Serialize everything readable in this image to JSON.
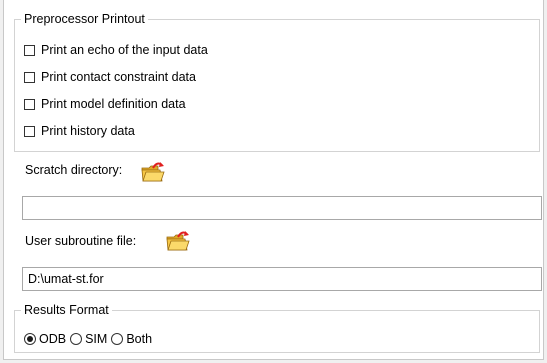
{
  "preprocessor": {
    "legend": "Preprocessor Printout",
    "options": [
      {
        "label": "Print an echo of the input data",
        "checked": false
      },
      {
        "label": "Print contact constraint data",
        "checked": false
      },
      {
        "label": "Print model definition data",
        "checked": false
      },
      {
        "label": "Print history data",
        "checked": false
      }
    ]
  },
  "scratch_directory": {
    "label": "Scratch directory:",
    "value": "",
    "browse_icon": "folder-open-icon"
  },
  "user_subroutine": {
    "label": "User subroutine file:",
    "value": "D:\\umat-st.for",
    "browse_icon": "folder-open-icon"
  },
  "results_format": {
    "legend": "Results Format",
    "options": [
      {
        "label": "ODB",
        "selected": true
      },
      {
        "label": "SIM",
        "selected": false
      },
      {
        "label": "Both",
        "selected": false
      }
    ]
  },
  "colors": {
    "folder_fill": "#f6c745",
    "folder_arrow": "#e02020",
    "border": "#a8a8a8"
  }
}
